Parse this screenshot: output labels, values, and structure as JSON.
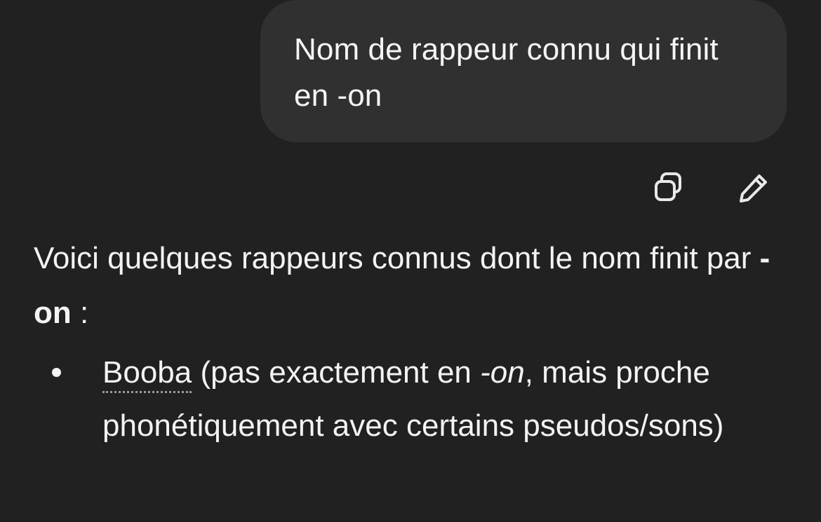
{
  "user_message": {
    "text": "Nom de rappeur connu qui finit en -on"
  },
  "bubble_actions": {
    "copy_icon": "copy-icon",
    "edit_icon": "pencil-icon"
  },
  "assistant_message": {
    "intro_prefix": "Voici quelques rappeurs connus dont le nom finit par ",
    "intro_bold": "-on",
    "intro_suffix": " :",
    "items": [
      {
        "name": "Booba",
        "text_before_italic": " (pas exactement en ",
        "italic": "-on",
        "text_after_italic": ", mais proche phonétiquement avec certains pseudos/sons)"
      }
    ]
  },
  "colors": {
    "background": "#212121",
    "bubble": "#303030",
    "text": "#f3f3f3"
  }
}
